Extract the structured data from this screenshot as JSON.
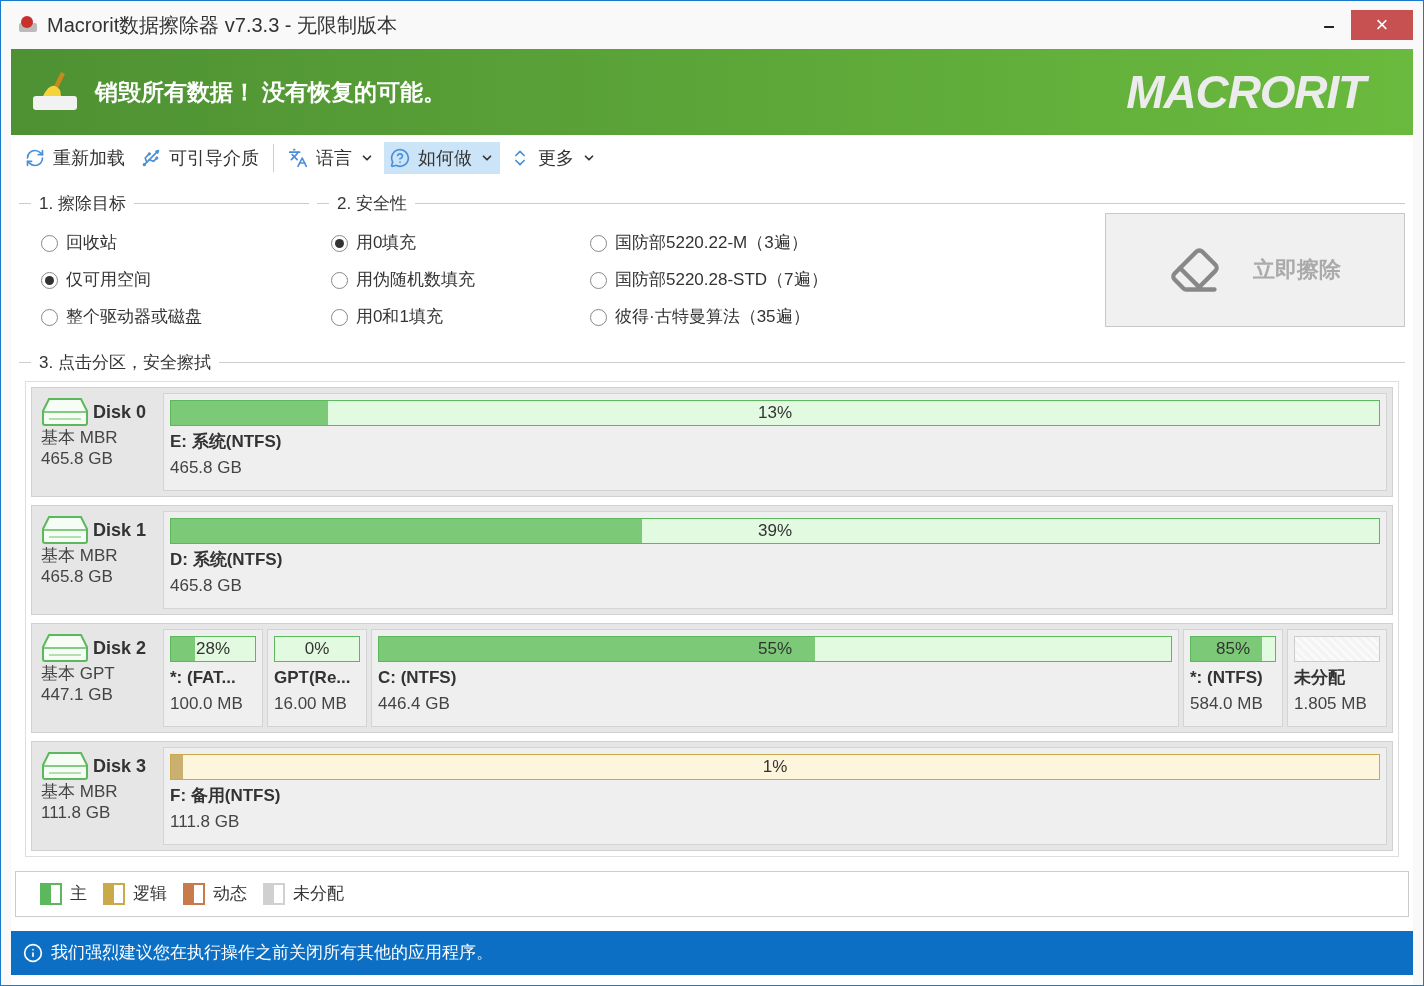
{
  "window": {
    "title": "Macrorit数据擦除器 v7.3.3 - 无限制版本",
    "minimize": "–",
    "close": "×"
  },
  "banner": {
    "slogan": "销毁所有数据！ 没有恢复的可能。",
    "logo": "MACRORIT"
  },
  "toolbar": [
    {
      "label": "重新加载",
      "kind": "reload",
      "dropdown": false,
      "selected": false
    },
    {
      "label": "可引导介质",
      "kind": "usb",
      "dropdown": false,
      "selected": false
    },
    {
      "label": "语言",
      "kind": "language",
      "dropdown": true,
      "selected": false
    },
    {
      "label": "如何做",
      "kind": "help",
      "dropdown": true,
      "selected": true
    },
    {
      "label": "更多",
      "kind": "more",
      "dropdown": true,
      "selected": false
    }
  ],
  "target": {
    "title": "1. 擦除目标",
    "options": [
      {
        "label": "回收站",
        "selected": false
      },
      {
        "label": "仅可用空间",
        "selected": true
      },
      {
        "label": "整个驱动器或磁盘",
        "selected": false
      }
    ]
  },
  "security": {
    "title": "2. 安全性",
    "options": [
      {
        "label": "用0填充",
        "selected": true
      },
      {
        "label": "用伪随机数填充",
        "selected": false
      },
      {
        "label": "用0和1填充",
        "selected": false
      },
      {
        "label": "国防部5220.22-M（3遍）",
        "selected": false
      },
      {
        "label": "国防部5220.28-STD（7遍）",
        "selected": false
      },
      {
        "label": "彼得·古特曼算法（35遍）",
        "selected": false
      }
    ]
  },
  "wipe_button": {
    "label": "立即擦除",
    "disabled": true
  },
  "partitions_section": {
    "title": "3. 点击分区，安全擦拭"
  },
  "disks": [
    {
      "name": "Disk 0",
      "type": "基本 MBR",
      "size": "465.8 GB",
      "partitions": [
        {
          "kind": "primary",
          "percent": "13%",
          "level": 0.13,
          "label": "E: 系统(NTFS)",
          "size": "465.8 GB"
        }
      ]
    },
    {
      "name": "Disk 1",
      "type": "基本 MBR",
      "size": "465.8 GB",
      "partitions": [
        {
          "kind": "primary",
          "percent": "39%",
          "level": 0.39,
          "label": "D: 系统(NTFS)",
          "size": "465.8 GB"
        }
      ]
    },
    {
      "name": "Disk 2",
      "type": "基本 GPT",
      "size": "447.1 GB",
      "partitions": [
        {
          "kind": "primary",
          "percent": "28%",
          "level": 0.28,
          "label": "*: (FAT...",
          "size": "100.0 MB"
        },
        {
          "kind": "primary",
          "percent": "0%",
          "label": "GPT(Re...",
          "size": "16.00 MB"
        },
        {
          "kind": "primary",
          "percent": "55%",
          "level": 0.55,
          "label": "C: (NTFS)",
          "size": "446.4 GB"
        },
        {
          "kind": "primary",
          "percent": "85%",
          "level": 0.85,
          "label": "*: (NTFS)",
          "size": "584.0 MB"
        },
        {
          "kind": "unallocated",
          "label": "未分配",
          "size": "1.805 MB"
        }
      ]
    },
    {
      "name": "Disk 3",
      "type": "基本 MBR",
      "size": "111.8 GB",
      "partitions": [
        {
          "kind": "logical",
          "percent": "1%",
          "level": 0.01,
          "label": "F: 备用(NTFS)",
          "size": "111.8 GB"
        }
      ]
    }
  ],
  "legend": [
    {
      "label": "主",
      "color": "#5cb85c"
    },
    {
      "label": "逻辑",
      "color": "#c9a94a"
    },
    {
      "label": "动态",
      "color": "#c97a4a"
    },
    {
      "label": "未分配",
      "color": "#d0d0d0"
    }
  ],
  "status_bar": {
    "message": "我们强烈建议您在执行操作之前关闭所有其他的应用程序。"
  }
}
